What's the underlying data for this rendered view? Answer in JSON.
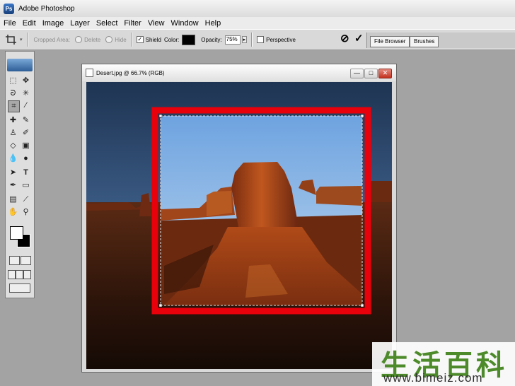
{
  "app": {
    "title": "Adobe Photoshop",
    "icon": "photoshop-app-icon"
  },
  "menu": [
    "File",
    "Edit",
    "Image",
    "Layer",
    "Select",
    "Filter",
    "View",
    "Window",
    "Help"
  ],
  "options_bar": {
    "cropped_area_label": "Cropped Area:",
    "delete_label": "Delete",
    "hide_label": "Hide",
    "shield_label": "Shield",
    "color_label": "Color:",
    "opacity_label": "Opacity:",
    "opacity_value": "75%",
    "perspective_label": "Perspective",
    "cancel_glyph": "⊘",
    "commit_glyph": "✓",
    "shield_color": "#000000"
  },
  "palette_well": {
    "tabs": [
      "File Browser",
      "Brushes"
    ]
  },
  "document": {
    "title": "Desert.jpg @ 66.7% (RGB)",
    "minimize_glyph": "—",
    "maximize_glyph": "□",
    "close_glyph": "✕"
  },
  "tools": [
    "marquee",
    "move",
    "lasso",
    "magic-wand",
    "crop",
    "slice",
    "healing",
    "brush",
    "stamp",
    "history-brush",
    "eraser",
    "gradient",
    "blur",
    "dodge",
    "path-select",
    "type",
    "pen",
    "shape",
    "notes",
    "eyedropper",
    "hand",
    "zoom"
  ],
  "highlight": {
    "color": "#e8000a"
  },
  "watermark": {
    "chars": "生活百科",
    "url": "www.bimeiz.com"
  }
}
